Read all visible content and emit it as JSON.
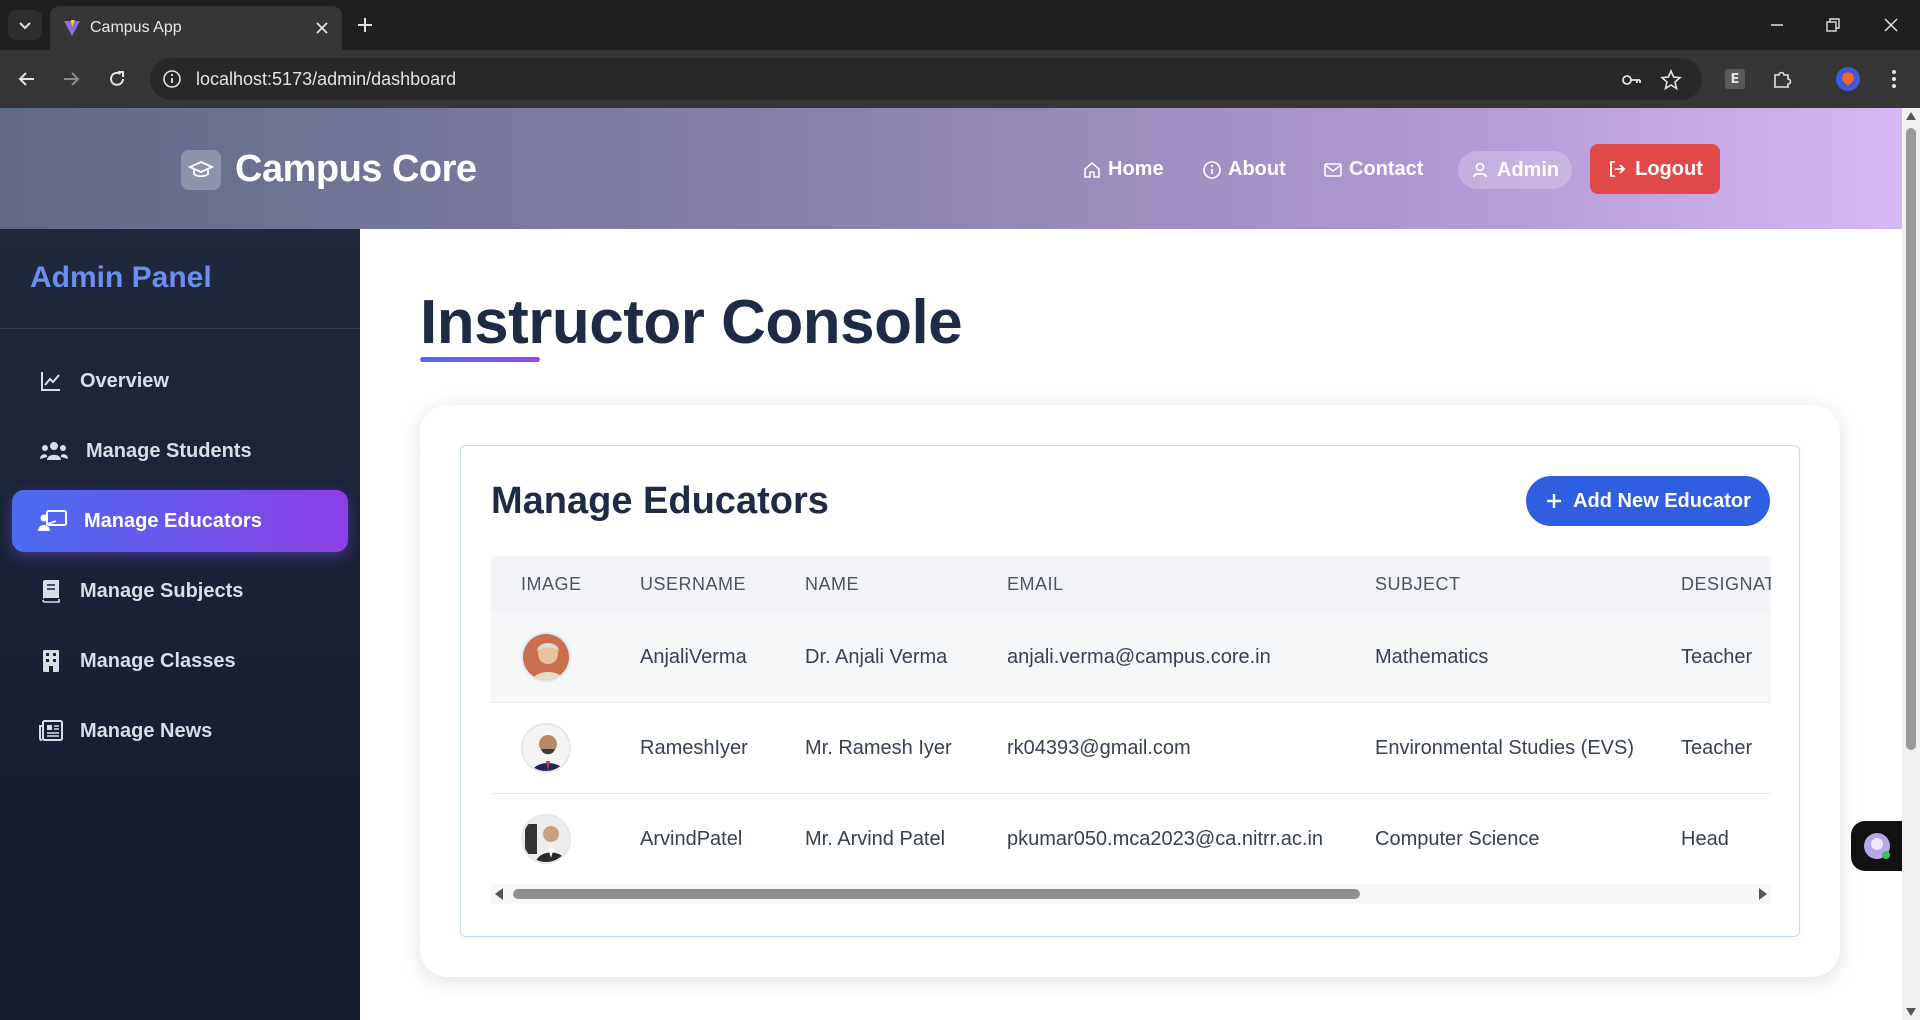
{
  "browser": {
    "tab_title": "Campus App",
    "url": "localhost:5173/admin/dashboard",
    "extension_label": "E"
  },
  "header": {
    "brand": "Campus Core",
    "nav": {
      "home": "Home",
      "about": "About",
      "contact": "Contact",
      "admin": "Admin",
      "logout": "Logout"
    }
  },
  "sidebar": {
    "title": "Admin Panel",
    "items": [
      {
        "label": "Overview",
        "icon": "chart-line-icon"
      },
      {
        "label": "Manage Students",
        "icon": "users-icon"
      },
      {
        "label": "Manage Educators",
        "icon": "chalkboard-teacher-icon",
        "active": true
      },
      {
        "label": "Manage Subjects",
        "icon": "book-icon"
      },
      {
        "label": "Manage Classes",
        "icon": "building-icon"
      },
      {
        "label": "Manage News",
        "icon": "newspaper-icon"
      }
    ]
  },
  "main": {
    "page_title": "Instructor Console",
    "section_title": "Manage Educators",
    "add_button": "Add New Educator",
    "table": {
      "columns": [
        "IMAGE",
        "USERNAME",
        "NAME",
        "EMAIL",
        "SUBJECT",
        "DESIGNAT"
      ],
      "rows": [
        {
          "username": "AnjaliVerma",
          "name": "Dr. Anjali Verma",
          "email": "anjali.verma@campus.core.in",
          "subject": "Mathematics",
          "designation": "Teacher"
        },
        {
          "username": "RameshIyer",
          "name": "Mr. Ramesh Iyer",
          "email": "rk04393@gmail.com",
          "subject": "Environmental Studies (EVS)",
          "designation": "Teacher"
        },
        {
          "username": "ArvindPatel",
          "name": "Mr. Arvind Patel",
          "email": "pkumar050.mca2023@ca.nitrr.ac.in",
          "subject": "Computer Science",
          "designation": "Head"
        }
      ]
    }
  },
  "colors": {
    "accent_blue": "#2f5fe0",
    "logout_red": "#e24a4a",
    "sidebar_title": "#6b8ef0",
    "active_gradient_start": "#4a6cf0",
    "active_gradient_end": "#8b3fe6"
  }
}
